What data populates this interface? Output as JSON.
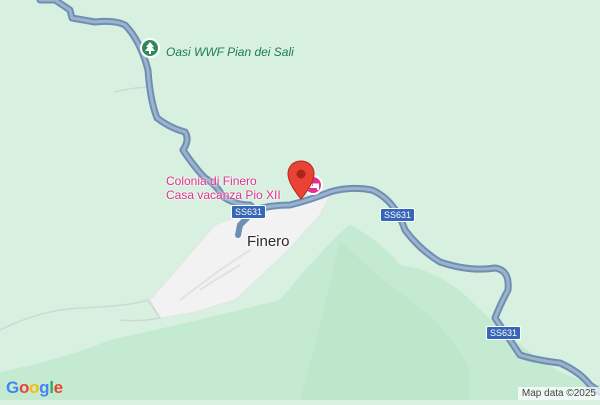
{
  "map": {
    "poi": {
      "name": "Oasi WWF Pian dei Sali",
      "icon": "tree-icon"
    },
    "hotel": {
      "line1": "Colonia di Finero",
      "line2": "Casa vacanza Pio XII",
      "icon": "bed-icon"
    },
    "town": "Finero",
    "road_shields": [
      "SS631",
      "SS631",
      "SS631"
    ],
    "marker": "red-pin-marker",
    "logo": [
      "G",
      "o",
      "o",
      "g",
      "l",
      "e"
    ],
    "attribution": "Map data ©2025",
    "colors": {
      "land": "#d8f0e0",
      "forest": "#c4ead2",
      "river": "#6e8fb4",
      "town_area": "#f2f2f2",
      "hotel": "#e0318e",
      "poi": "#2e8b57",
      "marker": "#ea4335",
      "shield": "#3566b8",
      "logo": [
        "#4285f4",
        "#ea4335",
        "#fbbc05",
        "#4285f4",
        "#34a853",
        "#ea4335"
      ]
    }
  }
}
